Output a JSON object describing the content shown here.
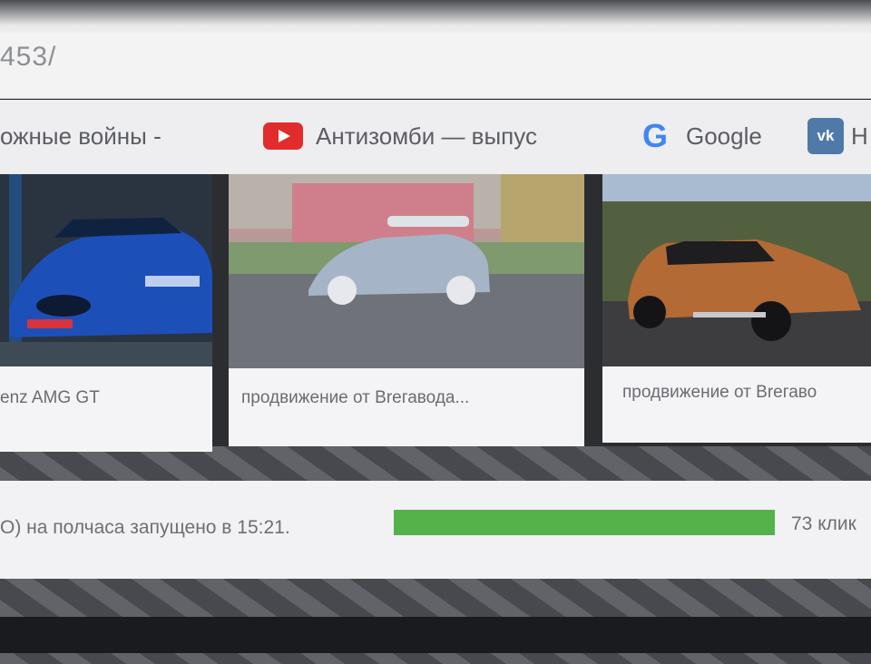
{
  "browser": {
    "url_fragment": "453/",
    "bookmarks": [
      {
        "label": "ожные войны -",
        "icon": "none"
      },
      {
        "label": "Антизомби — выпус",
        "icon": "youtube-icon"
      },
      {
        "label": "Google",
        "icon": "google-icon"
      },
      {
        "label": "Н",
        "icon": "vk-icon"
      }
    ]
  },
  "cards": [
    {
      "caption": "enz AMG GT",
      "photo": "blue-mercedes-amg-gt"
    },
    {
      "caption": "продвижение от Brегавода...",
      "photo": "silver-hatchback"
    },
    {
      "caption": "продвижение от Brегаво",
      "photo": "copper-volvo-xc60"
    }
  ],
  "status": {
    "text": "О) на полчаса запущено в 15:21.",
    "progress": 1.0,
    "clicks": "73 клик"
  },
  "colors": {
    "progress_fill": "#55b24a",
    "youtube_red": "#e22b2b",
    "vk_blue": "#4f79a8"
  }
}
